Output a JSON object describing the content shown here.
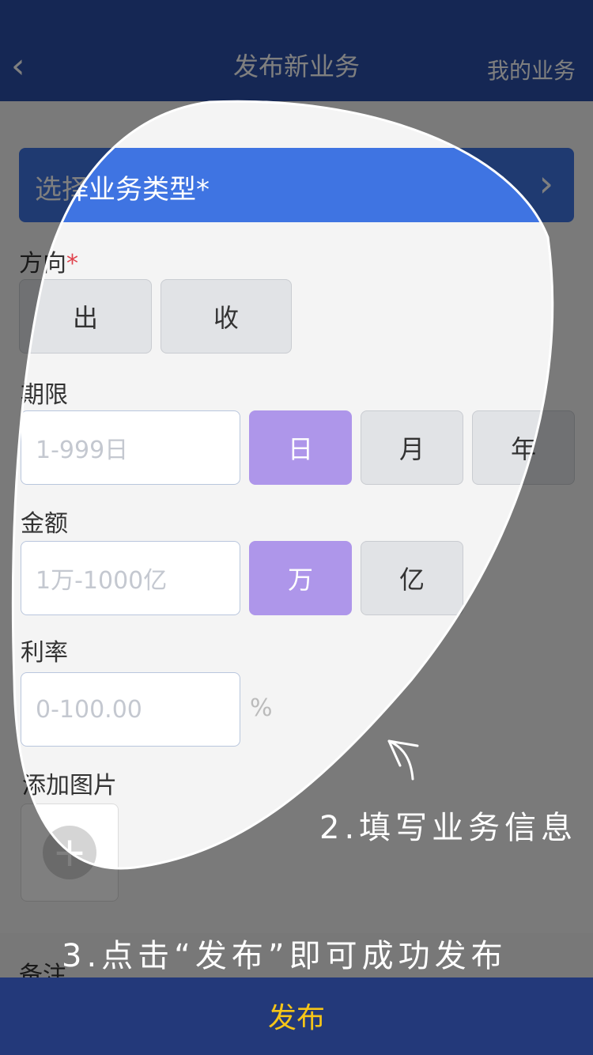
{
  "header": {
    "back_icon": "chevron-left-icon",
    "title": "发布新业务",
    "right_link": "我的业务"
  },
  "business_type": {
    "label": "选择业务类型*",
    "chevron_icon": "chevron-right-icon"
  },
  "direction": {
    "label": "方向",
    "required_mark": "*",
    "options": [
      "出",
      "收"
    ]
  },
  "term": {
    "label": "期限",
    "placeholder": "1-999日",
    "units": [
      "日",
      "月",
      "年"
    ],
    "selected_unit": "日"
  },
  "amount": {
    "label": "金额",
    "placeholder": "1万-1000亿",
    "units": [
      "万",
      "亿"
    ],
    "selected_unit": "万"
  },
  "rate": {
    "label": "利率",
    "placeholder": "0-100.00",
    "unit": "%"
  },
  "images": {
    "label": "添加图片",
    "add_icon": "plus-icon",
    "add_symbol": "+"
  },
  "remark": {
    "label": "备注"
  },
  "footer": {
    "publish_label": "发布"
  },
  "tutorial": {
    "step2": "2.填写业务信息",
    "step3": "3.点击“发布”即可成功发布"
  },
  "colors": {
    "header": "#2a4fa8",
    "type_bar": "#3f74e2",
    "selected": "#ae96ea",
    "publish_text": "#f5c518",
    "footer": "#23397a"
  }
}
